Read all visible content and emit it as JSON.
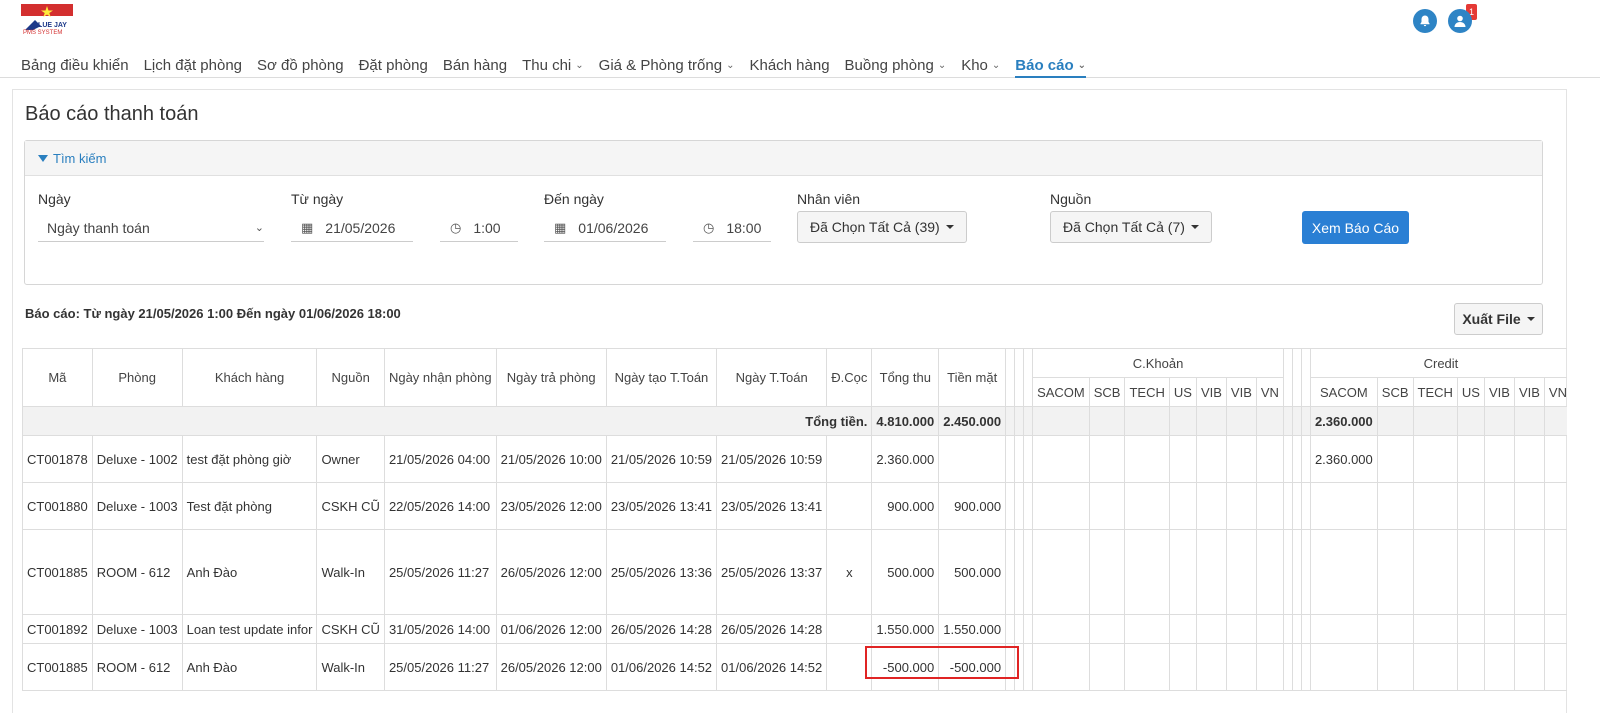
{
  "header": {
    "logo_text": "BLUE JAY",
    "logo_sub": "PMS SYSTEM",
    "notification_count": "1",
    "nav": [
      {
        "label": "Bảng điều khiển",
        "has_dropdown": false,
        "active": false
      },
      {
        "label": "Lịch đặt phòng",
        "has_dropdown": false,
        "active": false
      },
      {
        "label": "Sơ đồ phòng",
        "has_dropdown": false,
        "active": false
      },
      {
        "label": "Đặt phòng",
        "has_dropdown": false,
        "active": false
      },
      {
        "label": "Bán hàng",
        "has_dropdown": false,
        "active": false
      },
      {
        "label": "Thu chi",
        "has_dropdown": true,
        "active": false
      },
      {
        "label": "Giá & Phòng trống",
        "has_dropdown": true,
        "active": false
      },
      {
        "label": "Khách hàng",
        "has_dropdown": false,
        "active": false
      },
      {
        "label": "Buồng phòng",
        "has_dropdown": true,
        "active": false
      },
      {
        "label": "Kho",
        "has_dropdown": true,
        "active": false
      },
      {
        "label": "Báo cáo",
        "has_dropdown": true,
        "active": true
      }
    ]
  },
  "page": {
    "title": "Báo cáo thanh toán",
    "search_title": "Tìm kiếm",
    "filters": {
      "date_type_label": "Ngày",
      "date_type_value": "Ngày thanh toán",
      "from_label": "Từ ngày",
      "from_date": "21/05/2026",
      "from_time": "1:00",
      "to_label": "Đến ngày",
      "to_date": "01/06/2026",
      "to_time": "18:00",
      "staff_label": "Nhân viên",
      "staff_value": "Đã Chọn Tất Cả (39)",
      "source_label": "Nguồn",
      "source_value": "Đã Chọn Tất Cả (7)",
      "submit_label": "Xem Báo Cáo"
    },
    "report_range": "Báo cáo: Từ ngày 21/05/2026 1:00 Đến ngày 01/06/2026 18:00",
    "export_label": "Xuất File"
  },
  "table": {
    "columns": [
      "Mã",
      "Phòng",
      "Khách hàng",
      "Nguồn",
      "Ngày nhận phòng",
      "Ngày trả phòng",
      "Ngày tạo T.Toán",
      "Ngày T.Toán",
      "Đ.Cọc",
      "Tổng thu",
      "Tiền mặt"
    ],
    "group_ck": "C.Khoản",
    "group_credit": "Credit",
    "banks": [
      "SACOM",
      "SCB",
      "TECH",
      "US",
      "VIB",
      "VIB",
      "VN"
    ],
    "total_label": "Tổng tiền.",
    "total_tong_thu": "4.810.000",
    "total_tien_mat": "2.450.000",
    "total_credit_sacom": "2.360.000",
    "rows": [
      {
        "ma": "CT001878",
        "phong": "Deluxe - 1002",
        "khach": "test đặt phòng giờ",
        "nguon": "Owner",
        "nhan": "21/05/2026 04:00",
        "tra": "21/05/2026 10:00",
        "tao": "21/05/2026 10:59",
        "tt": "21/05/2026 10:59",
        "coc": "",
        "tong": "2.360.000",
        "tienmat": "",
        "credit_sacom": "2.360.000"
      },
      {
        "ma": "CT001880",
        "phong": "Deluxe - 1003",
        "khach": "Test đặt phòng",
        "nguon": "CSKH CŨ",
        "nhan": "22/05/2026 14:00",
        "tra": "23/05/2026 12:00",
        "tao": "23/05/2026 13:41",
        "tt": "23/05/2026 13:41",
        "coc": "",
        "tong": "900.000",
        "tienmat": "900.000",
        "credit_sacom": ""
      },
      {
        "ma": "CT001885",
        "phong": "ROOM - 612",
        "khach": "Anh Đào",
        "nguon": "Walk-In",
        "nhan": "25/05/2026 11:27",
        "tra": "26/05/2026 12:00",
        "tao": "25/05/2026 13:36",
        "tt": "25/05/2026 13:37",
        "coc": "x",
        "tong": "500.000",
        "tienmat": "500.000",
        "credit_sacom": ""
      },
      {
        "ma": "CT001892",
        "phong": "Deluxe - 1003",
        "khach": "Loan test update infor",
        "nguon": "CSKH CŨ",
        "nhan": "31/05/2026 14:00",
        "tra": "01/06/2026 12:00",
        "tao": "26/05/2026 14:28",
        "tt": "26/05/2026 14:28",
        "coc": "",
        "tong": "1.550.000",
        "tienmat": "1.550.000",
        "credit_sacom": ""
      },
      {
        "ma": "CT001885",
        "phong": "ROOM - 612",
        "khach": "Anh Đào",
        "nguon": "Walk-In",
        "nhan": "25/05/2026 11:27",
        "tra": "26/05/2026 12:00",
        "tao": "01/06/2026 14:52",
        "tt": "01/06/2026 14:52",
        "coc": "",
        "tong": "-500.000",
        "tienmat": "-500.000",
        "credit_sacom": ""
      }
    ]
  }
}
